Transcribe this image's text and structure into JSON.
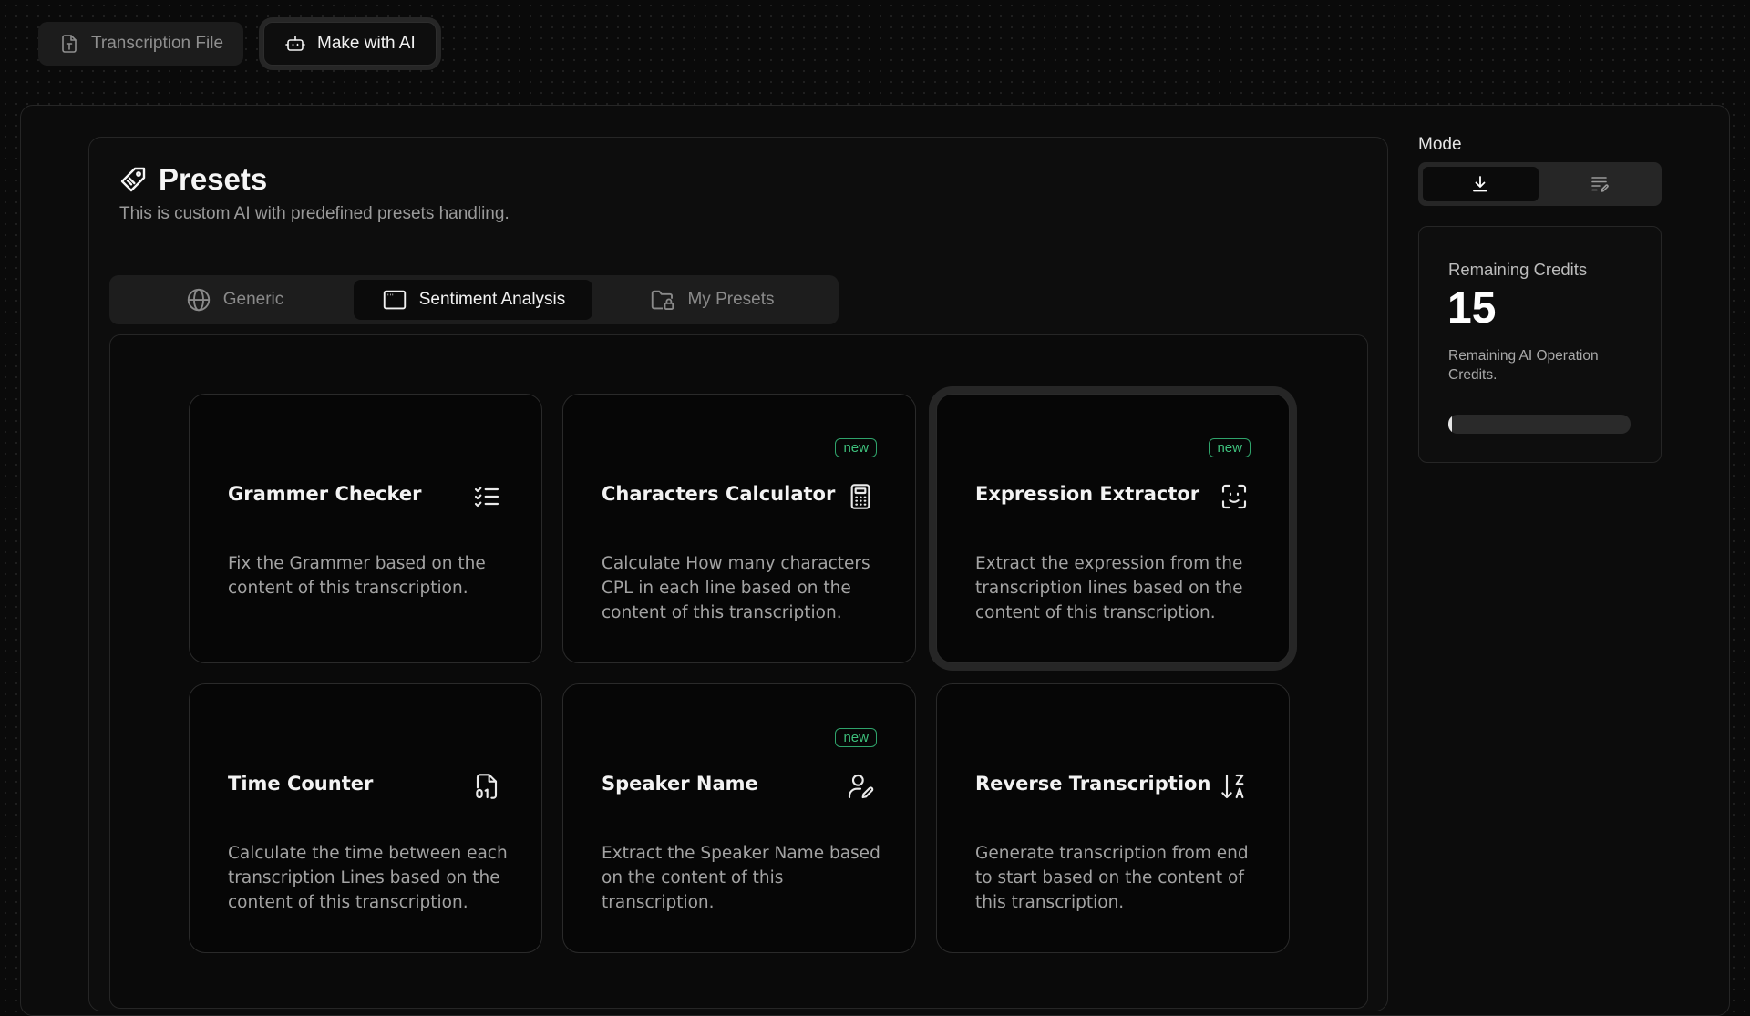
{
  "top_tabs": [
    {
      "label": "Transcription File",
      "icon": "file-text-icon",
      "active": false
    },
    {
      "label": "Make with AI",
      "icon": "robot-icon",
      "active": true
    }
  ],
  "presets": {
    "title": "Presets",
    "icon": "tag-icon",
    "description": "This is custom AI with predefined presets handling."
  },
  "category_tabs": [
    {
      "label": "Generic",
      "icon": "globe-icon",
      "active": false
    },
    {
      "label": "Sentiment Analysis",
      "icon": "browser-window-icon",
      "active": true
    },
    {
      "label": "My Presets",
      "icon": "folder-lock-icon",
      "active": false
    }
  ],
  "cards": [
    {
      "title": "Grammer Checker",
      "icon": "checklist-icon",
      "badge": "",
      "selected": false,
      "description": "Fix the Grammer based on the content of this transcription."
    },
    {
      "title": "Characters Calculator",
      "icon": "calculator-icon",
      "badge": "new",
      "selected": false,
      "description": "Calculate How many characters CPL in each line based on the content of this transcription."
    },
    {
      "title": "Expression Extractor",
      "icon": "face-scan-icon",
      "badge": "new",
      "selected": true,
      "description": "Extract the expression from the transcription lines based on the content of this transcription."
    },
    {
      "title": "Time Counter",
      "icon": "binary-file-icon",
      "badge": "",
      "selected": false,
      "description": "Calculate the time between each transcription Lines based on the content of this transcription."
    },
    {
      "title": "Speaker Name",
      "icon": "user-edit-icon",
      "badge": "new",
      "selected": false,
      "description": "Extract the Speaker Name based on the content of this transcription."
    },
    {
      "title": "Reverse Transcription",
      "icon": "sort-z-a-icon",
      "badge": "",
      "selected": false,
      "description": "Generate transcription from end to start based on the content of this transcription."
    }
  ],
  "mode": {
    "label": "Mode",
    "options": [
      {
        "icon": "download-icon",
        "active": true
      },
      {
        "icon": "edit-list-icon",
        "active": false
      }
    ]
  },
  "credits": {
    "label": "Remaining Credits",
    "value": "15",
    "note": "Remaining AI Operation Credits.",
    "progress_fraction": 0.02
  },
  "colors": {
    "badge_green": "#3ec07c",
    "background": "#0a0a0a",
    "panel_border": "#262626"
  }
}
